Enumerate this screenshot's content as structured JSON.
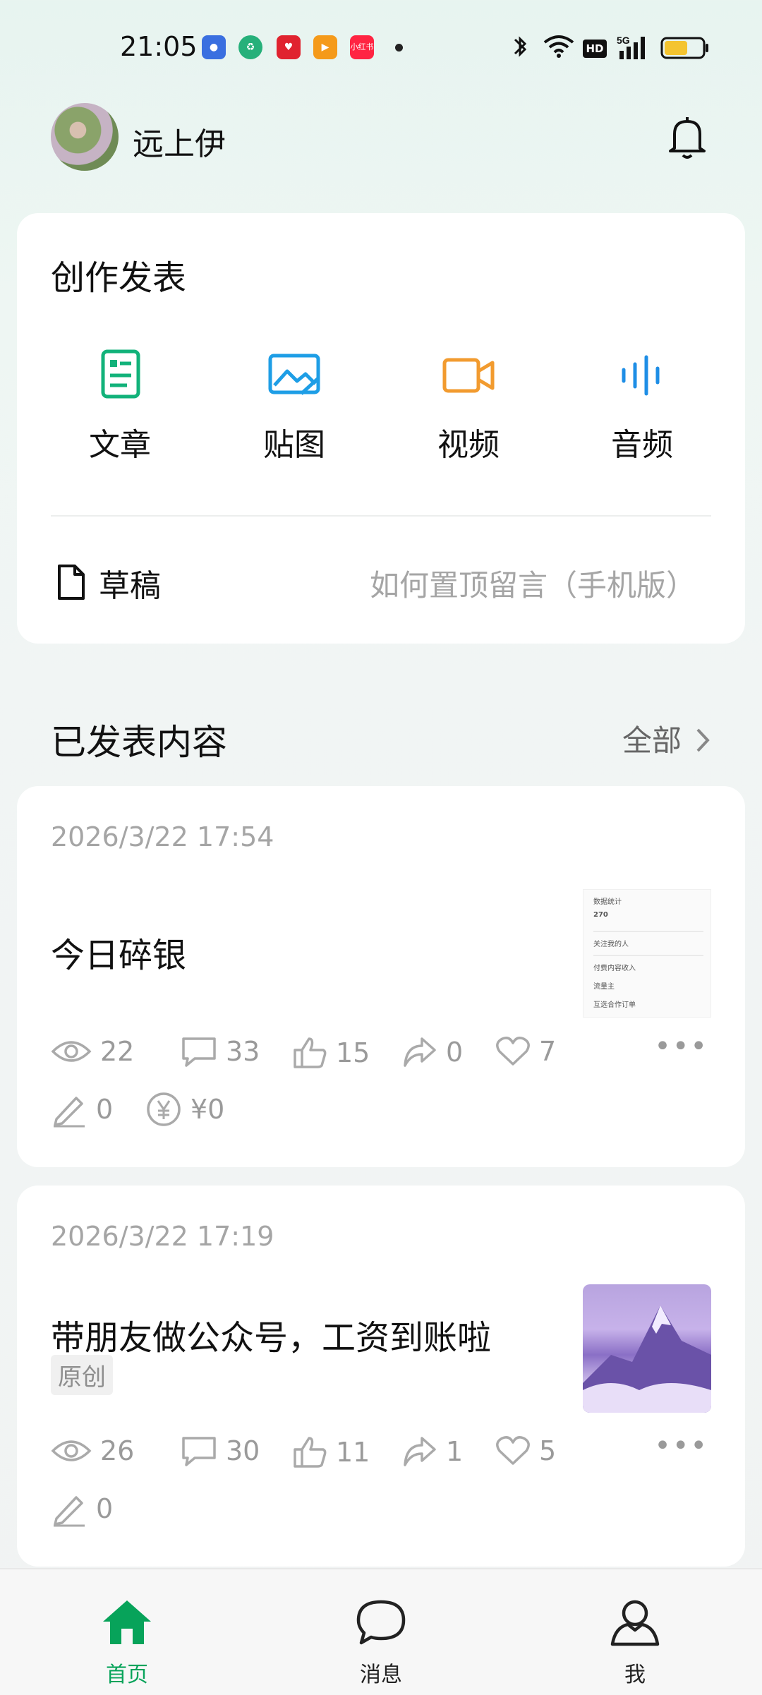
{
  "status_bar": {
    "time": "21:05",
    "icons": [
      "bluetooth-icon",
      "wifi-icon",
      "hd-icon",
      "signal-5g-icon",
      "battery-icon"
    ],
    "apps": [
      {
        "name": "baidu-app-icon",
        "color": "#3a6fe0"
      },
      {
        "name": "recycle-app-icon",
        "color": "#26b07a"
      },
      {
        "name": "heart-app-icon",
        "color": "#e0232f"
      },
      {
        "name": "video-app-icon",
        "color": "#f59a1a"
      },
      {
        "name": "xiaohongshu-app-icon",
        "color": "#ff2442",
        "text": "小红书"
      }
    ]
  },
  "header": {
    "username": "远上伊"
  },
  "create": {
    "title": "创作发表",
    "items": [
      {
        "label": "文章",
        "icon": "article-icon",
        "color": "#12b27a"
      },
      {
        "label": "贴图",
        "icon": "image-icon",
        "color": "#1e9ee6"
      },
      {
        "label": "视频",
        "icon": "video-icon",
        "color": "#f29b2f"
      },
      {
        "label": "音频",
        "icon": "audio-icon",
        "color": "#1e8ee6"
      }
    ],
    "draft_label": "草稿",
    "draft_hint": "如何置顶留言（手机版）"
  },
  "published": {
    "title": "已发表内容",
    "all_label": "全部",
    "posts": [
      {
        "date": "2026/3/22 17:54",
        "title": "今日碎银",
        "thumb_lines": [
          "数据统计",
          "270",
          "关注我的人",
          "付费内容收入",
          "流量主",
          "互选合作订单"
        ],
        "stats": {
          "views": "22",
          "comments": "33",
          "likes": "15",
          "shares": "0",
          "favorites": "7",
          "edits": "0",
          "income": "¥0"
        }
      },
      {
        "date": "2026/3/22 17:19",
        "title": "带朋友做公众号，工资到账啦",
        "tag": "原创",
        "stats": {
          "views": "26",
          "comments": "30",
          "likes": "11",
          "shares": "1",
          "favorites": "5",
          "edits": "0"
        }
      }
    ]
  },
  "bottom_nav": {
    "items": [
      {
        "label": "首页",
        "icon": "home-icon",
        "active": true
      },
      {
        "label": "消息",
        "icon": "chat-bubble-icon",
        "active": false
      },
      {
        "label": "我",
        "icon": "person-icon",
        "active": false
      }
    ],
    "active_color": "#07a35a"
  }
}
